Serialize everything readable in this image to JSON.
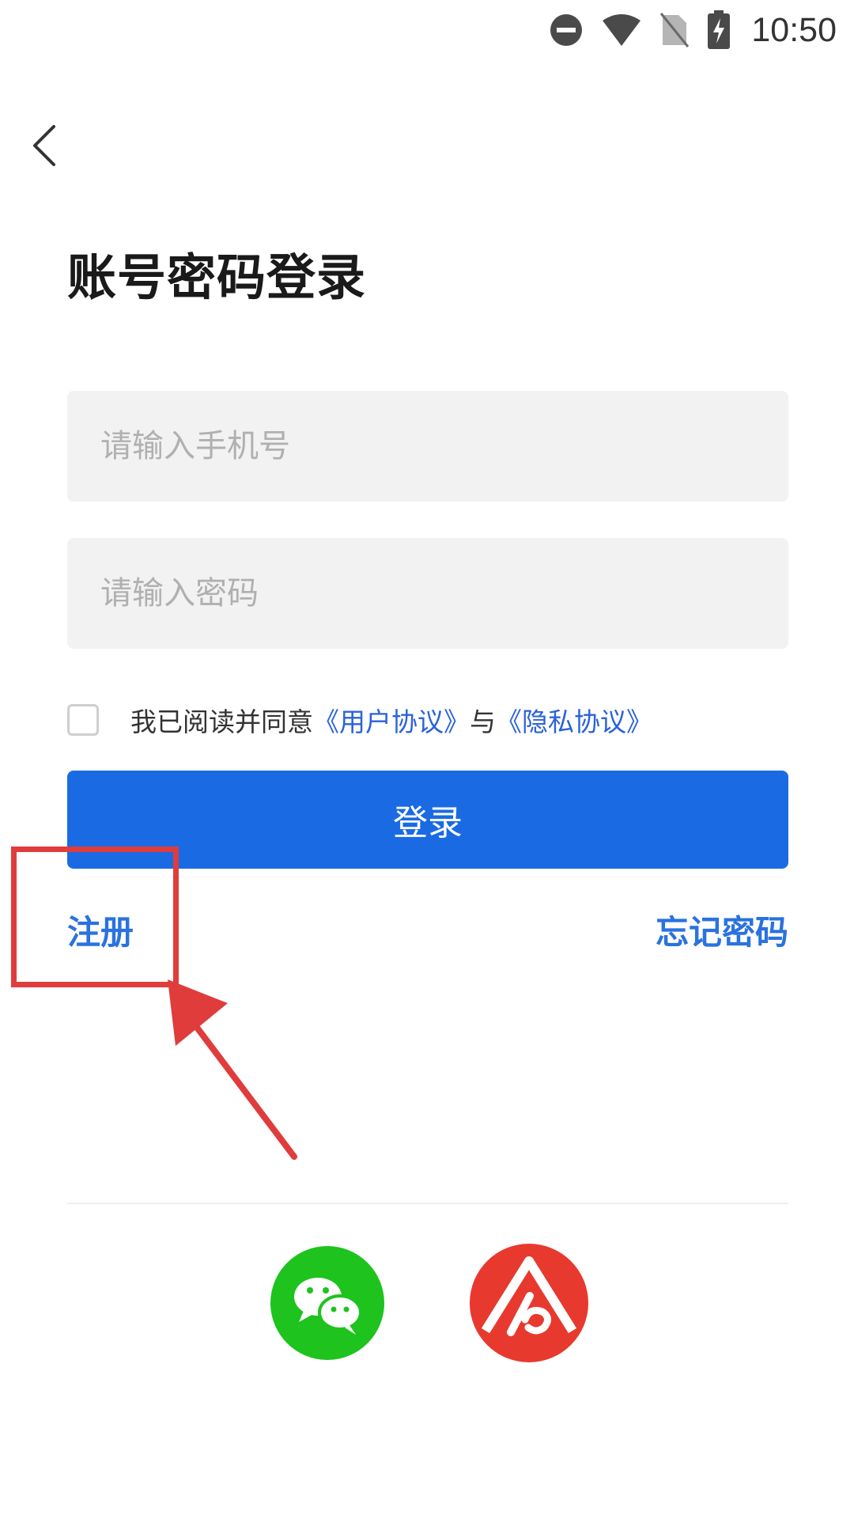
{
  "status_bar": {
    "time": "10:50",
    "icons": [
      "do-not-disturb-icon",
      "wifi-icon",
      "no-sim-icon",
      "battery-charging-icon"
    ]
  },
  "header": {
    "back_icon": "chevron-left-icon",
    "title": "账号密码登录"
  },
  "form": {
    "phone_placeholder": "请输入手机号",
    "phone_value": "",
    "password_placeholder": "请输入密码",
    "password_value": "",
    "agreement": {
      "checked": false,
      "prefix": "我已阅读并同意",
      "user_agreement": "《用户协议》",
      "conjunction": "与",
      "privacy_agreement": "《隐私协议》"
    },
    "login_label": "登录",
    "register_label": "注册",
    "forgot_label": "忘记密码"
  },
  "third_party": {
    "icons": [
      "wechat-icon",
      "app-logo-icon"
    ]
  },
  "colors": {
    "primary": "#1a6be3",
    "link": "#2a72df",
    "agreement_link": "#2b62d9",
    "annotation": "#e03c3c",
    "wechat": "#1ec31e",
    "app_logo": "#e8392f",
    "input_bg": "#f2f2f2"
  }
}
